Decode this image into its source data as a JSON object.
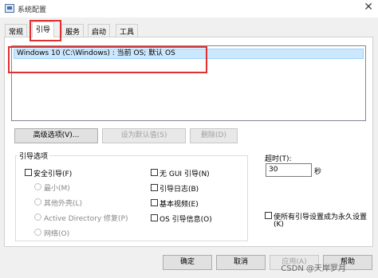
{
  "window": {
    "title": "系统配置",
    "close_glyph": "✕"
  },
  "tabs": [
    {
      "label": "常规",
      "active": false
    },
    {
      "label": "引导",
      "active": true
    },
    {
      "label": "服务",
      "active": false
    },
    {
      "label": "启动",
      "active": false
    },
    {
      "label": "工具",
      "active": false
    }
  ],
  "boot_list": {
    "entries": [
      "Windows 10 (C:\\Windows) : 当前 OS; 默认 OS"
    ]
  },
  "list_buttons": {
    "advanced": "高级选项(V)...",
    "set_default": "设为默认值(S)",
    "delete": "删除(D)"
  },
  "boot_options": {
    "group_title": "引导选项",
    "safe_boot": "安全引导(F)",
    "minimal": "最小(M)",
    "alternate_shell": "其他外壳(L)",
    "active_directory": "Active Directory 修复(P)",
    "network": "网络(O)",
    "no_gui": "无 GUI 引导(N)",
    "boot_log": "引导日志(B)",
    "base_video": "基本视频(E)",
    "os_boot_info": "OS 引导信息(O)"
  },
  "timeout": {
    "label": "超时(T):",
    "value": "30",
    "unit": "秒"
  },
  "permanent": {
    "line1": "使所有引导设置成为永久设置",
    "line2": "(K)"
  },
  "footer": {
    "ok": "确定",
    "cancel": "取消",
    "apply": "应用(A)",
    "help": "帮助"
  },
  "watermark": "CSDN @天岸罗月"
}
